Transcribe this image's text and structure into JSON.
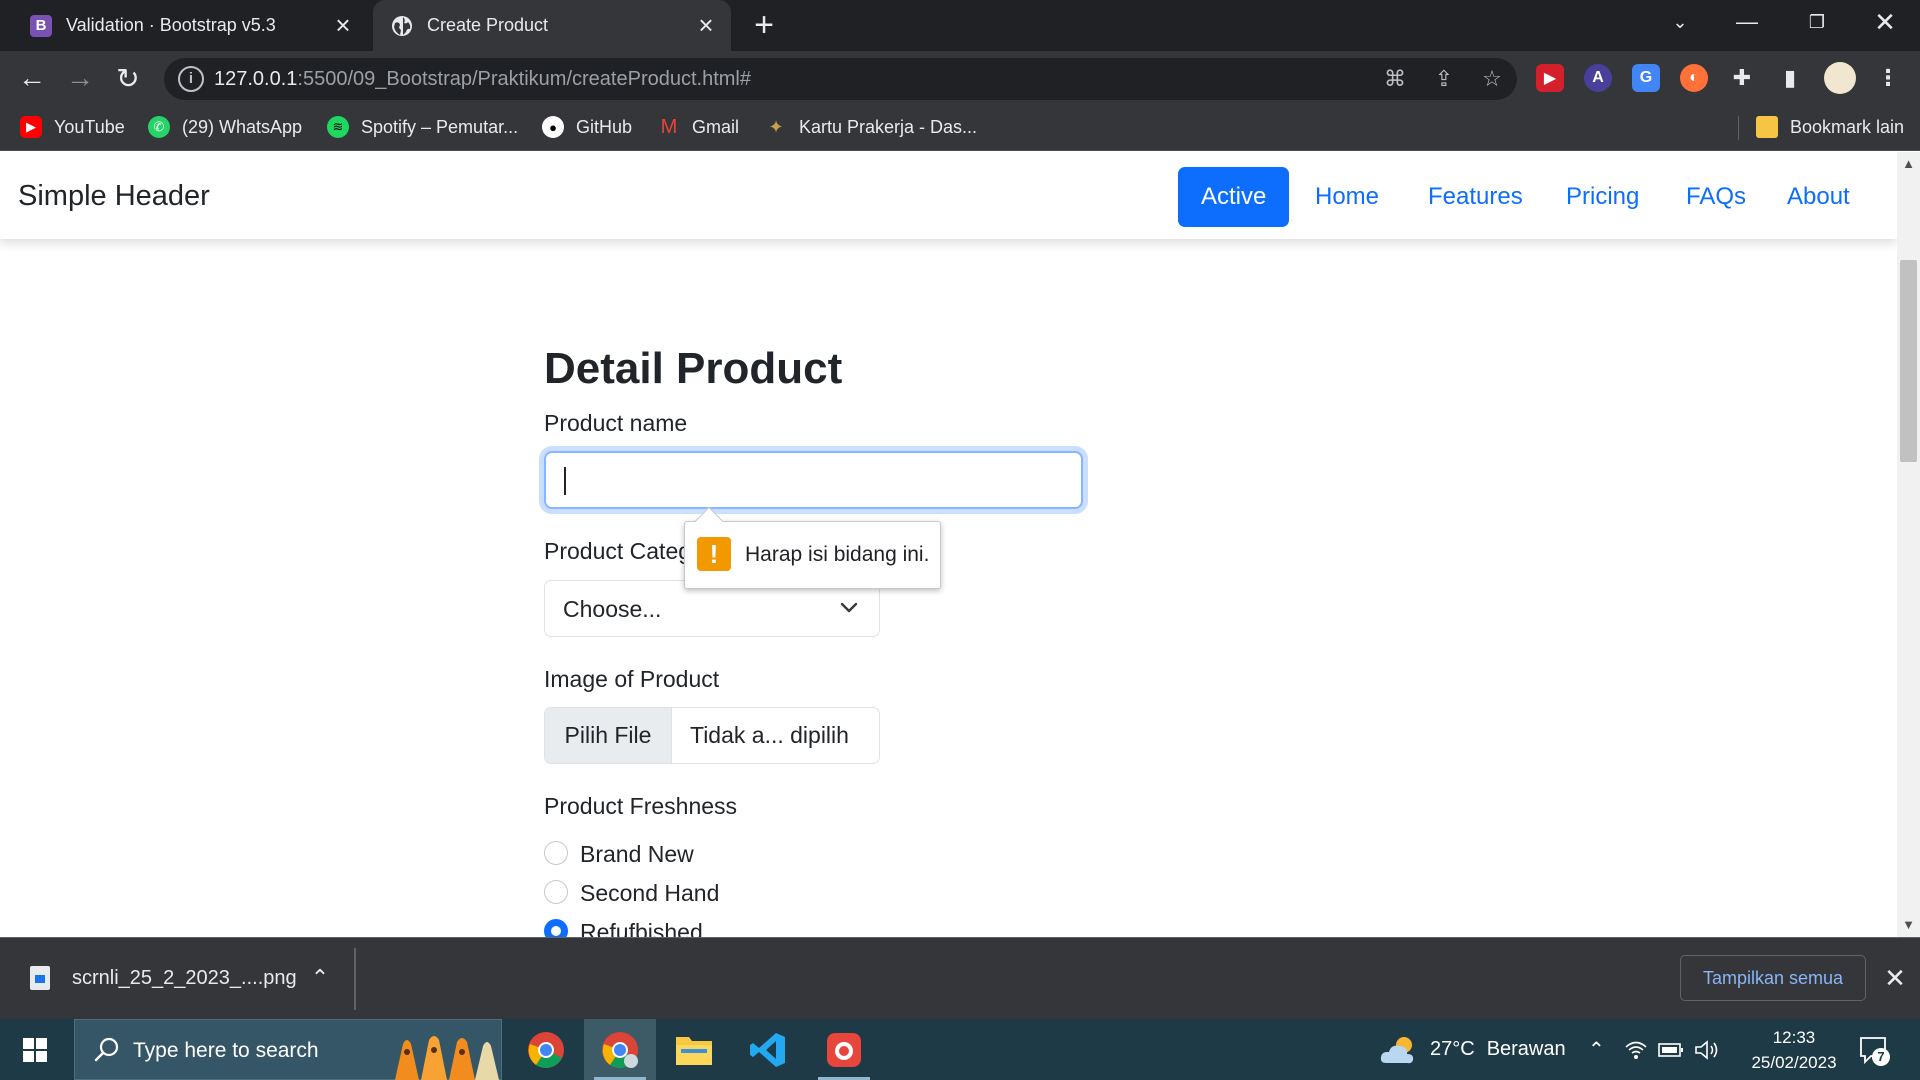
{
  "browser": {
    "tabs": [
      {
        "title": "Validation · Bootstrap v5.3",
        "favicon": "B",
        "active": false
      },
      {
        "title": "Create Product",
        "active": true
      }
    ],
    "url_host": "127.0.0.1",
    "url_rest": ":5500/09_Bootstrap/Praktikum/createProduct.html#",
    "bookmarks": [
      {
        "label": "YouTube",
        "icon": "youtube-icon",
        "color": "#ff0000"
      },
      {
        "label": "(29) WhatsApp",
        "icon": "whatsapp-icon",
        "color": "#25d366"
      },
      {
        "label": "Spotify – Pemutar...",
        "icon": "spotify-icon",
        "color": "#1ed760"
      },
      {
        "label": "GitHub",
        "icon": "github-icon",
        "color": "#ffffff"
      },
      {
        "label": "Gmail",
        "icon": "gmail-icon",
        "color": "#ea4335"
      },
      {
        "label": "Kartu Prakerja - Das...",
        "icon": "garuda-icon",
        "color": "#c8a04a"
      }
    ],
    "other_bookmarks": "Bookmark lain"
  },
  "page": {
    "brand": "Simple Header",
    "nav": [
      "Active",
      "Home",
      "Features",
      "Pricing",
      "FAQs",
      "About"
    ],
    "heading": "Detail Product",
    "product_name_label": "Product name",
    "product_category_label": "Product Category",
    "category_value": "Choose...",
    "image_label": "Image of Product",
    "file_button": "Pilih File",
    "file_status": "Tidak a... dipilih",
    "freshness_label": "Product Freshness",
    "freshness_options": [
      {
        "label": "Brand New",
        "checked": false
      },
      {
        "label": "Second Hand",
        "checked": false
      },
      {
        "label": "Refufbished",
        "checked": true
      }
    ],
    "validation_message": "Harap isi bidang ini."
  },
  "download": {
    "file": "scrnli_25_2_2023_....png",
    "show_all": "Tampilkan semua"
  },
  "taskbar": {
    "search_placeholder": "Type here to search",
    "temperature": "27°C",
    "weather": "Berawan",
    "time": "12:33",
    "date": "25/02/2023",
    "notifications": "7"
  },
  "colors": {
    "primary": "#0d6efd",
    "chrome_dark": "#202124",
    "chrome_toolbar": "#35363a",
    "taskbar": "#1e3a47",
    "warning": "#f29900"
  }
}
